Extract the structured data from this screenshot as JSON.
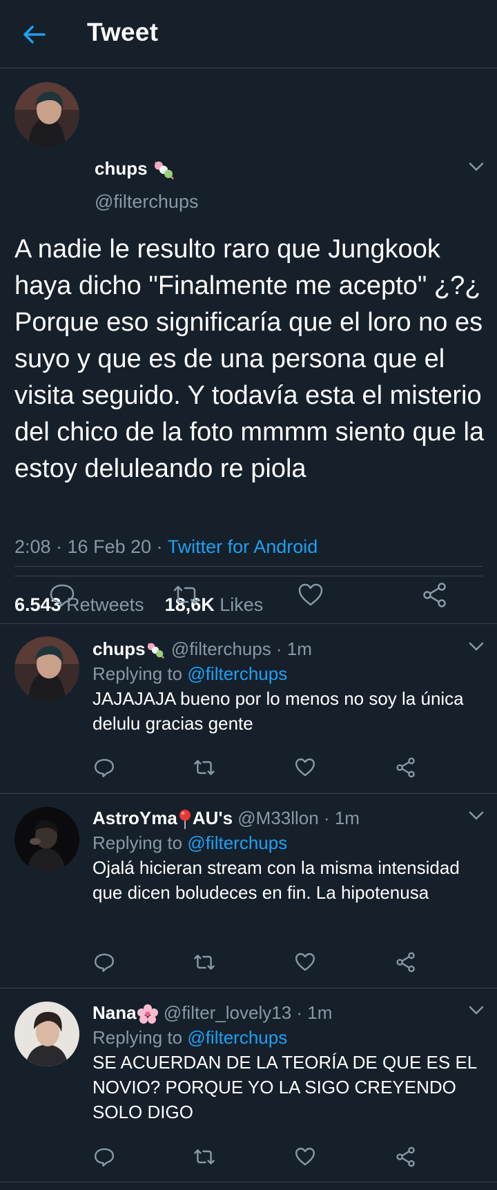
{
  "header": {
    "title": "Tweet"
  },
  "main_tweet": {
    "name": "chups",
    "handle": "@filterchups",
    "text": "A nadie le resulto raro que Jungkook haya dicho \"Finalmente me acepto\" ¿?¿ Porque eso significaría que el loro no es suyo y que es de una persona que el visita seguido. Y todavía esta el misterio del chico de la foto mmmm siento que la estoy deluleando re piola",
    "time": "2:08 · 16 Feb 20 · ",
    "source": "Twitter for Android",
    "retweets_count": "6.543",
    "retweets_label": "Retweets",
    "likes_count": "18,6K",
    "likes_label": "Likes"
  },
  "replies": [
    {
      "name": "chups",
      "handle_time": "@filterchups · 1m",
      "replying_prefix": "Replying to ",
      "replying_to": "@filterchups",
      "text": "JAJAJAJA bueno por lo menos no soy la única delulu gracias gente"
    },
    {
      "name": "AstroYma",
      "name_suffix": "AU's",
      "handle_time": "@M33llon · 1m",
      "replying_prefix": "Replying to ",
      "replying_to": "@filterchups",
      "text": "Ojalá hicieran stream con la misma intensidad que dicen boludeces en fin. La hipotenusa"
    },
    {
      "name": "Nana",
      "handle_time": "@filter_lovely13 · 1m",
      "replying_prefix": "Replying to ",
      "replying_to": "@filterchups",
      "text": "SE ACUERDAN DE LA TEORÍA DE QUE ES EL NOVIO? PORQUE YO LA SIGO CREYENDO SOLO DIGO"
    }
  ],
  "colors": {
    "background": "#15202b",
    "accent": "#1da1f2",
    "muted": "#8899a6",
    "divider": "#38444d"
  },
  "icons": [
    "back-arrow-icon",
    "chevron-down-icon",
    "reply-icon",
    "retweet-icon",
    "like-icon",
    "share-icon",
    "dango-emoji-icon",
    "pin-emoji-icon",
    "cherry-blossom-emoji-icon"
  ]
}
